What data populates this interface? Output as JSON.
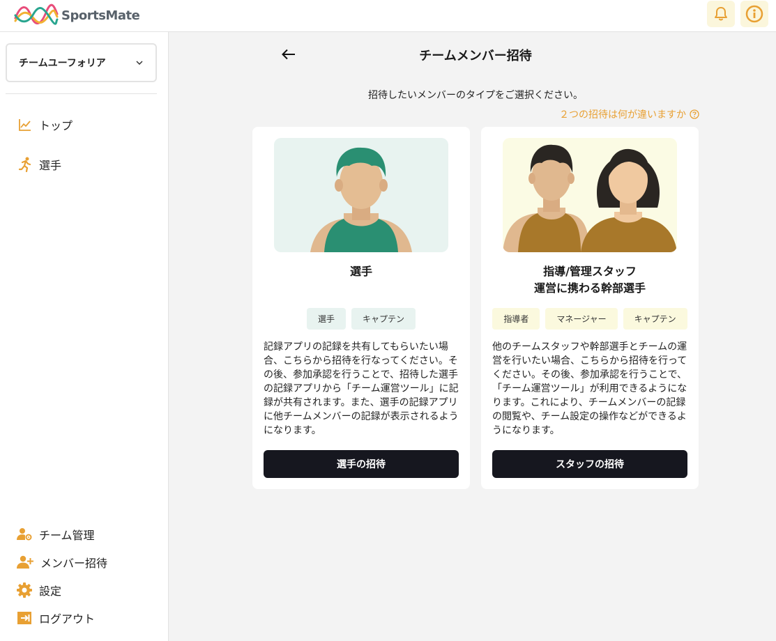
{
  "app": {
    "logo_text": "SportsMate"
  },
  "header": {
    "bell_icon": "bell-icon",
    "info_icon": "info-icon",
    "accent": "#e8a033"
  },
  "sidebar": {
    "team_select": {
      "value": "チームユーフォリア"
    },
    "nav": [
      {
        "label": "トップ",
        "icon": "chart-icon"
      },
      {
        "label": "選手",
        "icon": "runner-icon"
      }
    ],
    "bottom_nav": [
      {
        "label": "チーム管理",
        "icon": "team-settings-icon"
      },
      {
        "label": "メンバー招待",
        "icon": "add-user-icon"
      },
      {
        "label": "設定",
        "icon": "gear-icon"
      },
      {
        "label": "ログアウト",
        "icon": "logout-icon"
      }
    ]
  },
  "main": {
    "title": "チームメンバー招待",
    "instruction": "招待したいメンバーのタイプをご選択ください。",
    "diff_link": "２つの招待は何が違いますか",
    "cards": [
      {
        "title": "選手",
        "tags": [
          "選手",
          "キャプテン"
        ],
        "description": "記録アプリの記録を共有してもらいたい場合、こちらから招待を行なってください。その後、参加承認を行うことで、招待した選手の記録アプリから「チーム運営ツール」に記録が共有されます。また、選手の記録アプリに他チームメンバーの記録が表示されるようになります。",
        "button": "選手の招待"
      },
      {
        "title_line1": "指導/管理スタッフ",
        "title_line2": "運営に携わる幹部選手",
        "tags": [
          "指導者",
          "マネージャー",
          "キャプテン"
        ],
        "description": "他のチームスタッフや幹部選手とチームの運営を行いたい場合、こちらから招待を行ってください。その後、参加承認を行うことで、「チーム運営ツール」が利用できるようになります。これにより、チームメンバーの記録の閲覧や、チーム設定の操作などができるようになります。",
        "button": "スタッフの招待"
      }
    ]
  }
}
